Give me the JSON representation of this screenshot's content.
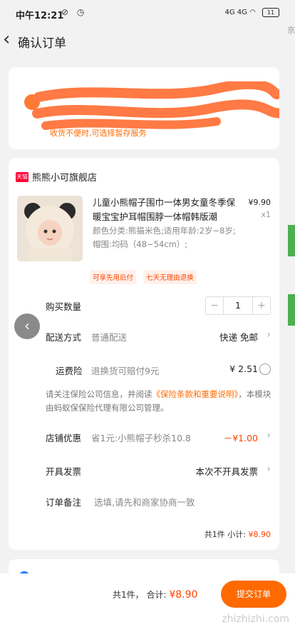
{
  "status": {
    "time": "中午12:21",
    "icons": "⊘ ◷",
    "signal": "4G 4G",
    "battery": "11"
  },
  "header": {
    "title": "确认订单",
    "edge_text": "京"
  },
  "address": {
    "notice": "收货不便时,可选择暂存服务"
  },
  "shop": {
    "badge": "天猫",
    "name": "熊熊小可旗舰店"
  },
  "product": {
    "title": "儿童小熊帽子围巾一体男女童冬季保暖宝宝护耳帽围脖一体帽韩版潮",
    "price": "¥9.90",
    "qty_mark": "x1",
    "spec": "颜色分类:熊猫米色;适用年龄:2岁~8岁;帽围:均码（48~54cm）;",
    "tags": [
      "可享先用后付",
      "七天无理由退换"
    ]
  },
  "quantity": {
    "label": "购买数量",
    "value": "1",
    "minus": "−",
    "plus": "+"
  },
  "delivery": {
    "label": "配送方式",
    "value": "普通配送",
    "right": "快递 免邮"
  },
  "insurance": {
    "label": "运费险",
    "value": "退换货可赔付9元",
    "price": "¥ 2.51",
    "note_pre": "请关注保险公司信息，并阅读",
    "note_link": "《保险条款和重要说明》",
    "note_post": "，本模块由蚂蚁保保险代理有限公司管理。"
  },
  "discount": {
    "label": "店铺优惠",
    "value": "省1元:小熊帽子秒杀10.8",
    "amount": "－¥1.00"
  },
  "invoice": {
    "label": "开具发票",
    "value": "本次不开具发票"
  },
  "remark": {
    "label": "订单备注",
    "placeholder": "选填,请先和商家协商一致"
  },
  "subtotal": {
    "count": "共1件",
    "label": "小计:",
    "price": "¥8.90"
  },
  "footer": {
    "count": "共1件，",
    "label": "合计:",
    "price": "¥8.90",
    "submit": "提交订单",
    "watermark": "zhizhizhi.com"
  },
  "colors": {
    "accent": "#ff6a00",
    "price": "#ff4400",
    "tmall": "#ff0036"
  }
}
